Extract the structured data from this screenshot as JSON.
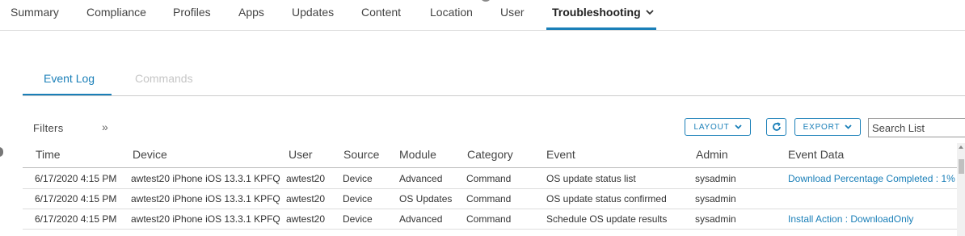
{
  "top_nav": {
    "tabs": [
      {
        "label": "Summary"
      },
      {
        "label": "Compliance"
      },
      {
        "label": "Profiles"
      },
      {
        "label": "Apps"
      },
      {
        "label": "Updates"
      },
      {
        "label": "Content"
      },
      {
        "label": "Location"
      },
      {
        "label": "User"
      },
      {
        "label": "Troubleshooting"
      }
    ],
    "active": "Troubleshooting",
    "accent_color": "#1a7fb8"
  },
  "sub_tabs": {
    "tabs": [
      {
        "label": "Event Log"
      },
      {
        "label": "Commands"
      }
    ],
    "active": "Event Log"
  },
  "toolbar": {
    "filters_label": "Filters",
    "layout_label": "LAYOUT",
    "export_label": "EXPORT",
    "refresh_icon": "refresh-icon",
    "search_placeholder": "Search List"
  },
  "table": {
    "columns": [
      "Time",
      "Device",
      "User",
      "Source",
      "Module",
      "Category",
      "Event",
      "Admin",
      "Event Data"
    ],
    "rows": [
      [
        "6/17/2020 4:15 PM",
        "awtest20 iPhone iOS 13.3.1 KPFQ",
        "awtest20",
        "Device",
        "Advanced",
        "Command",
        "OS update status list",
        "sysadmin",
        "Download Percentage Completed : 1%"
      ],
      [
        "6/17/2020 4:15 PM",
        "awtest20 iPhone iOS 13.3.1 KPFQ",
        "awtest20",
        "Device",
        "OS Updates",
        "Command",
        "OS update status confirmed",
        "sysadmin",
        ""
      ],
      [
        "6/17/2020 4:15 PM",
        "awtest20 iPhone iOS 13.3.1 KPFQ",
        "awtest20",
        "Device",
        "Advanced",
        "Command",
        "Schedule OS update results",
        "sysadmin",
        "Install Action : DownloadOnly"
      ]
    ]
  }
}
